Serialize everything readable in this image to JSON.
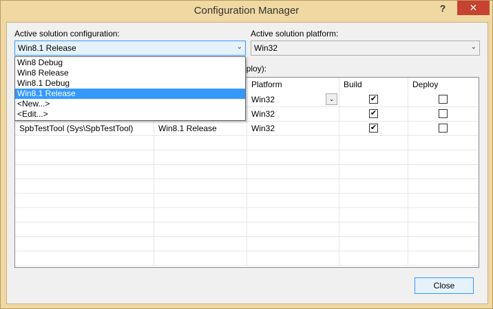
{
  "window": {
    "title": "Configuration Manager",
    "help_glyph": "?",
    "close_glyph": "✕"
  },
  "config": {
    "label": "Active solution configuration:",
    "selected": "Win8.1 Release",
    "options": [
      "Win8 Debug",
      "Win8 Release",
      "Win8.1 Debug",
      "Win8.1 Release",
      "<New...>",
      "<Edit...>"
    ],
    "highlighted_index": 3
  },
  "platform": {
    "label": "Active solution platform:",
    "selected": "Win32"
  },
  "contexts_label_partial": "eploy):",
  "grid": {
    "headers": [
      "Platform",
      "Build",
      "Deploy"
    ],
    "rows": [
      {
        "project": "",
        "configuration": "",
        "platform": "Win32",
        "build": true,
        "deploy": false
      },
      {
        "project": "",
        "configuration": "",
        "platform": "Win32",
        "build": true,
        "deploy": false
      },
      {
        "project": "SpbTestTool (Sys\\SpbTestTool)",
        "configuration": "Win8.1 Release",
        "platform": "Win32",
        "build": true,
        "deploy": false
      }
    ]
  },
  "buttons": {
    "close_label": "Close"
  },
  "glyphs": {
    "check": "✔",
    "combo_arrow": "⌄",
    "mini_arrow": "⌄"
  },
  "colors": {
    "titlebar_bg": "#f0d8a3",
    "close_btn_bg": "#c7432f",
    "selection": "#3399ff"
  }
}
